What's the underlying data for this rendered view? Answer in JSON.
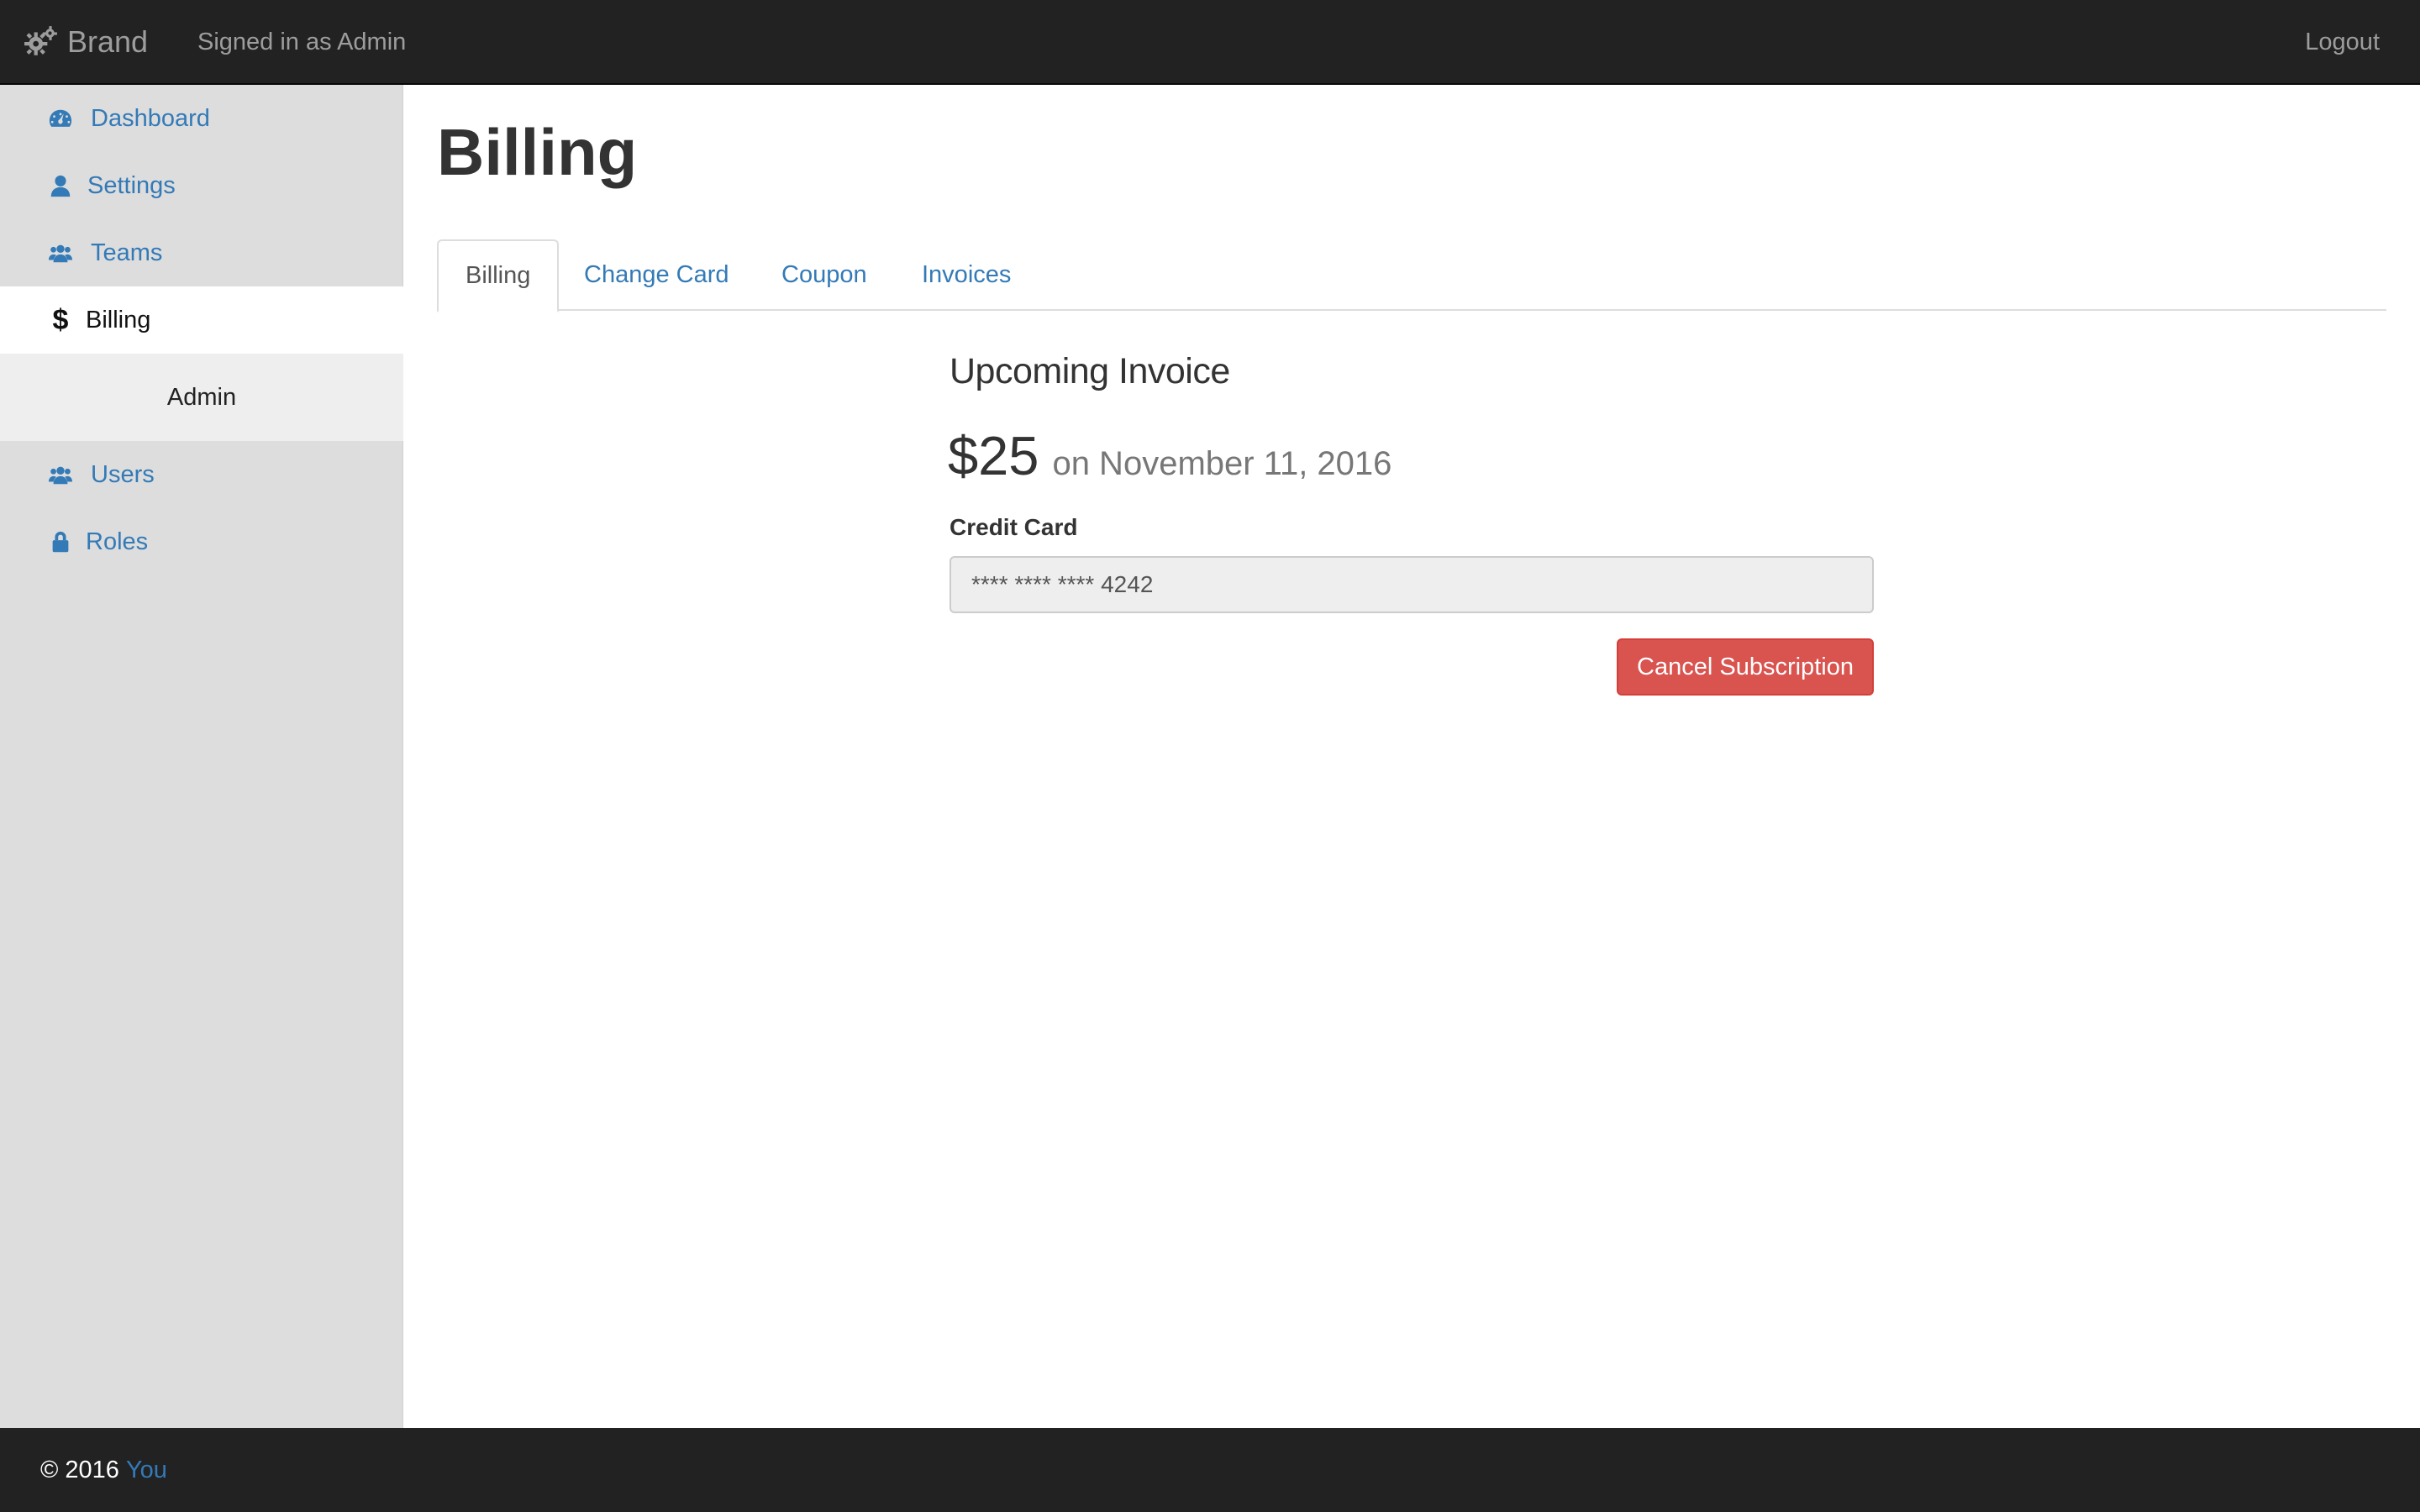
{
  "navbar": {
    "brand": "Brand",
    "brand_icon": "gears-icon",
    "signed_in": "Signed in as Admin",
    "logout": "Logout"
  },
  "sidebar": {
    "items": [
      {
        "label": "Dashboard",
        "icon": "dashboard-icon"
      },
      {
        "label": "Settings",
        "icon": "user-icon"
      },
      {
        "label": "Teams",
        "icon": "users-icon"
      },
      {
        "label": "Billing",
        "icon": "dollar-icon",
        "active": true
      }
    ],
    "section_label": "Admin",
    "admin_items": [
      {
        "label": "Users",
        "icon": "users-icon"
      },
      {
        "label": "Roles",
        "icon": "lock-icon"
      }
    ]
  },
  "main": {
    "title": "Billing",
    "tabs": [
      {
        "label": "Billing",
        "active": true
      },
      {
        "label": "Change Card"
      },
      {
        "label": "Coupon"
      },
      {
        "label": "Invoices"
      }
    ],
    "invoice": {
      "heading": "Upcoming Invoice",
      "amount": "$25",
      "date": "on November 11, 2016"
    },
    "credit_card": {
      "label": "Credit Card",
      "value": "**** **** **** 4242"
    },
    "cancel_label": "Cancel Subscription"
  },
  "footer": {
    "copyright": "© 2016",
    "link": "You"
  },
  "colors": {
    "navbar_bg": "#222222",
    "link": "#337ab7",
    "danger": "#d9534f",
    "sidebar_bg": "#dddddd"
  }
}
